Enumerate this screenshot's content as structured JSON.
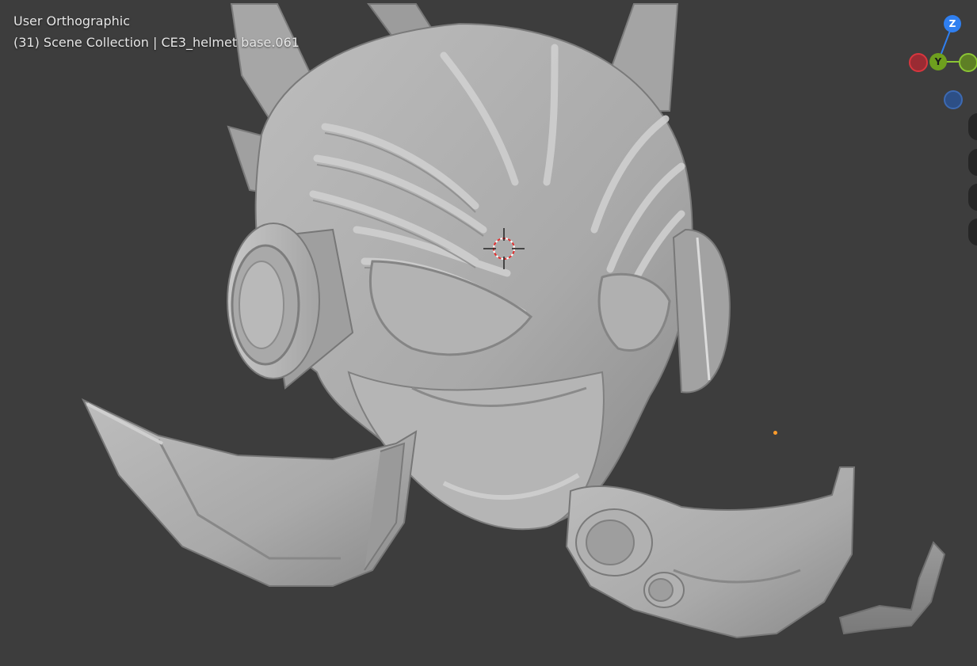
{
  "viewport": {
    "view_name": "User Orthographic",
    "collection_line": "(31) Scene Collection | CE3_helmet base.061"
  },
  "gizmo": {
    "axes": [
      {
        "label": "Z",
        "color": "#2f7ff0"
      },
      {
        "label": "Y",
        "color": "#6e9f1e"
      },
      {
        "label": "",
        "color": "#d9363e"
      },
      {
        "label": "",
        "color": "#8bc534"
      },
      {
        "label": "",
        "color": "#3d6ab3"
      }
    ]
  },
  "colors": {
    "background": "#3d3d3d",
    "mesh": "#a8a8a8",
    "origin": "#ff9c2b"
  },
  "navigation": {
    "buttons": [
      "zoom-icon",
      "pan-icon",
      "camera-icon",
      "ortho-grid-icon"
    ]
  }
}
